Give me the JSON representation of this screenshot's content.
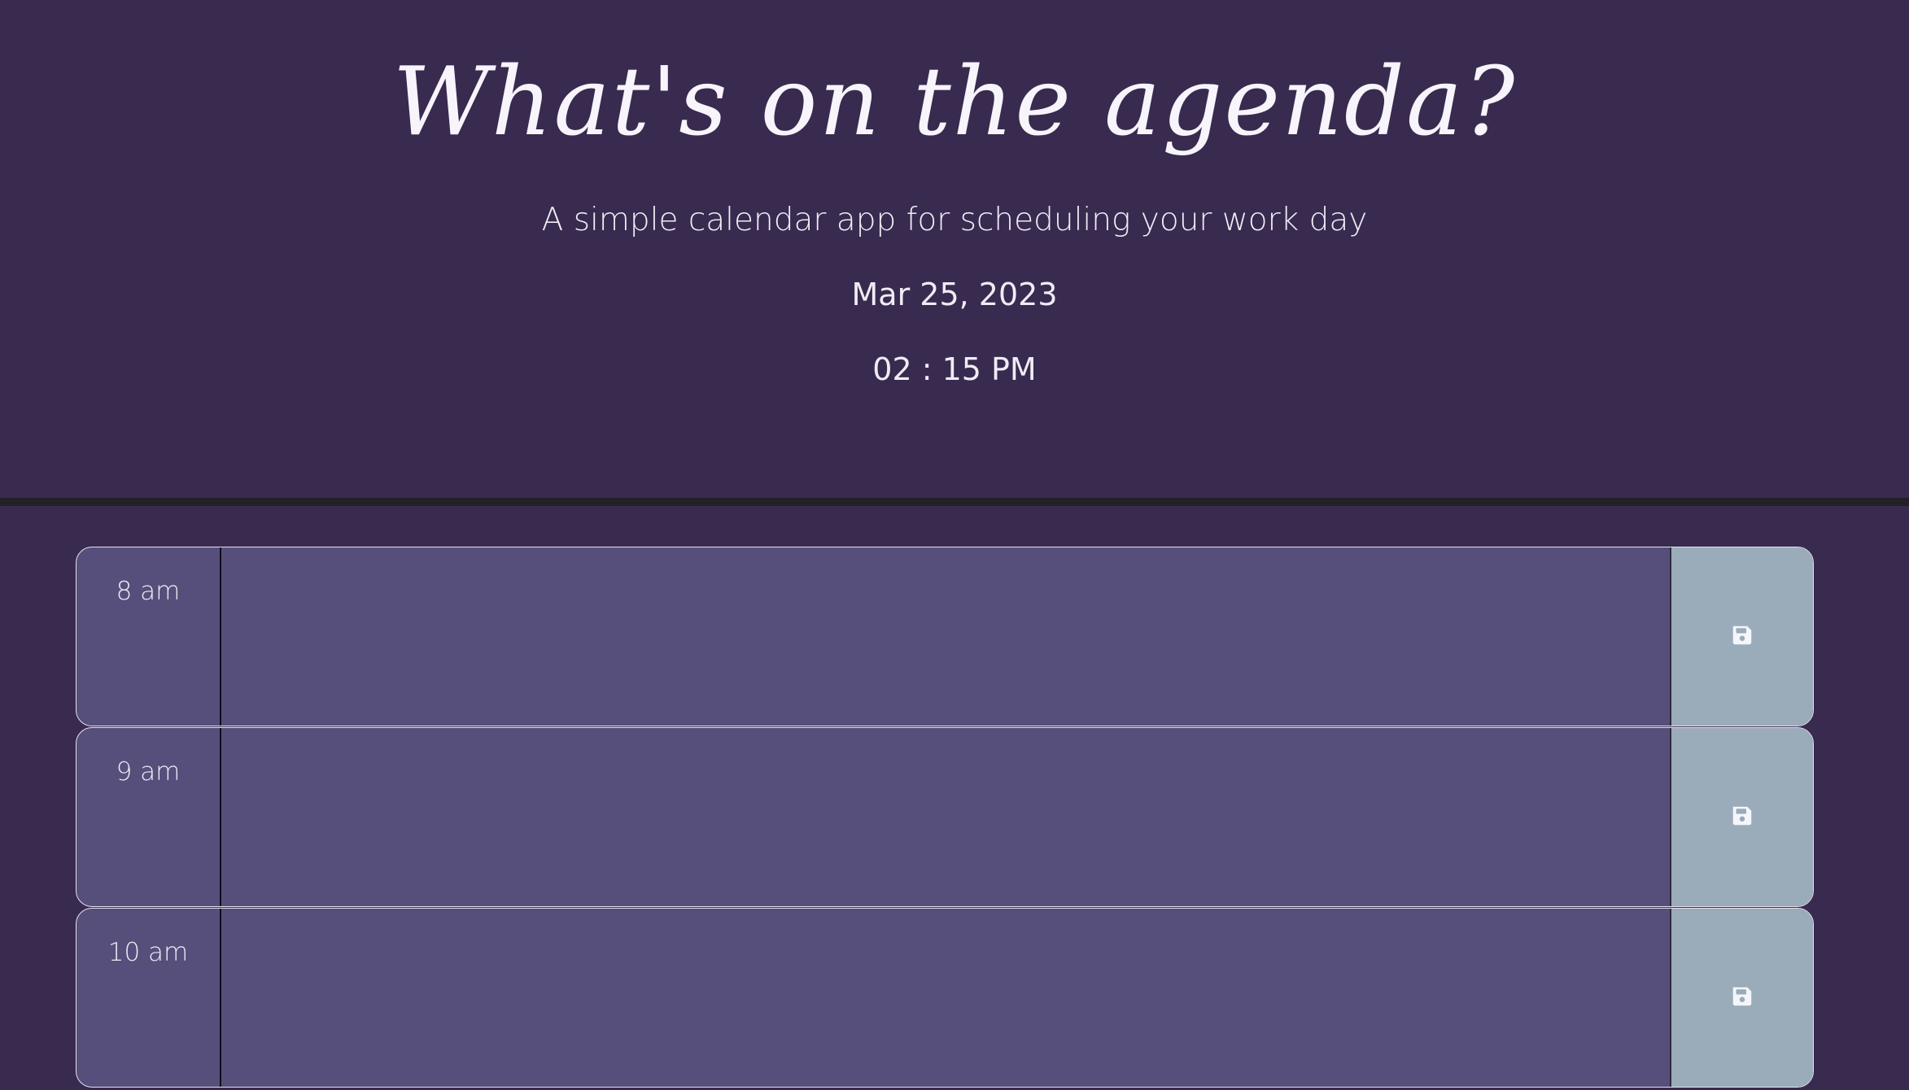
{
  "header": {
    "title": "What's on the agenda?",
    "subtitle": "A simple calendar app for scheduling your work day",
    "date": "Mar 25, 2023",
    "time": "02 : 15 PM"
  },
  "schedule": [
    {
      "hour": "8 am",
      "text": "",
      "save_icon": "floppy-disk-icon"
    },
    {
      "hour": "9 am",
      "text": "",
      "save_icon": "floppy-disk-icon"
    },
    {
      "hour": "10 am",
      "text": "",
      "save_icon": "floppy-disk-icon"
    }
  ],
  "colors": {
    "background": "#392a4f",
    "row": "#564f7b",
    "save_button": "#9aabba",
    "divider": "#222126"
  }
}
